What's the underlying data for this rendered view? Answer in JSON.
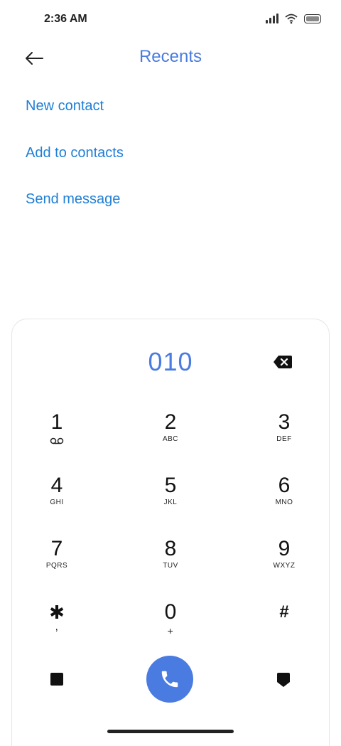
{
  "status_bar": {
    "time": "2:36 AM"
  },
  "header": {
    "title": "Recents"
  },
  "menu": {
    "items": [
      "New contact",
      "Add to contacts",
      "Send message"
    ]
  },
  "dialer": {
    "number": "010",
    "keys": [
      {
        "digit": "1",
        "letters": ""
      },
      {
        "digit": "2",
        "letters": "ABC"
      },
      {
        "digit": "3",
        "letters": "DEF"
      },
      {
        "digit": "4",
        "letters": "GHI"
      },
      {
        "digit": "5",
        "letters": "JKL"
      },
      {
        "digit": "6",
        "letters": "MNO"
      },
      {
        "digit": "7",
        "letters": "PQRS"
      },
      {
        "digit": "8",
        "letters": "TUV"
      },
      {
        "digit": "9",
        "letters": "WXYZ"
      },
      {
        "digit": "✱",
        "letters": ","
      },
      {
        "digit": "0",
        "letters": "+"
      },
      {
        "digit": "#",
        "letters": ""
      }
    ]
  },
  "icons": {
    "back": "arrow-left-icon",
    "backspace": "backspace-icon",
    "voicemail": "voicemail-icon",
    "call": "phone-icon",
    "left_action": "square-icon",
    "right_action": "tag-icon"
  },
  "colors": {
    "accent": "#4a7be0",
    "link": "#1f7fd6"
  }
}
